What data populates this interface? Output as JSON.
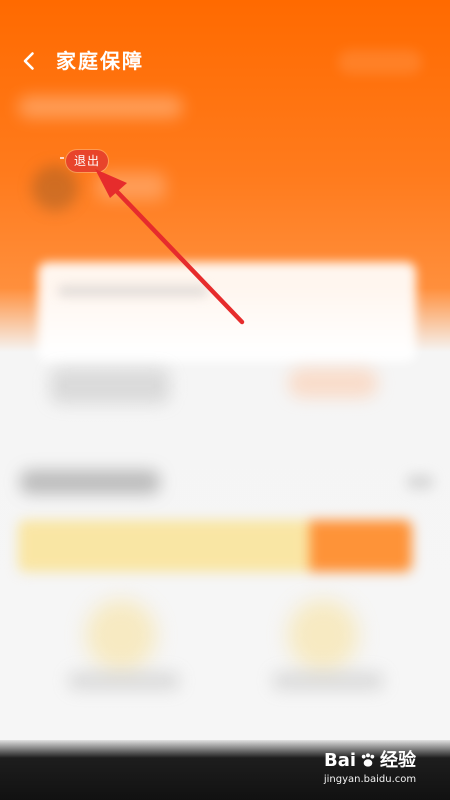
{
  "header": {
    "title": "家庭保障",
    "back_icon": "chevron-left-icon"
  },
  "badge": {
    "logout_label": "退出"
  },
  "annotation": {
    "arrow_color": "#e62c2c",
    "arrow_icon": "arrow-pointer-icon"
  },
  "colors": {
    "brand": "#ff6a00",
    "accent": "#ff8f3c",
    "badge": "#e8442b",
    "promo": "#fae396",
    "promo_action": "#ff851e"
  },
  "watermark": {
    "brand_left": "Bai",
    "brand_right": "经验",
    "subtitle": "jingyan.baidu.com",
    "icon": "paw-icon"
  }
}
